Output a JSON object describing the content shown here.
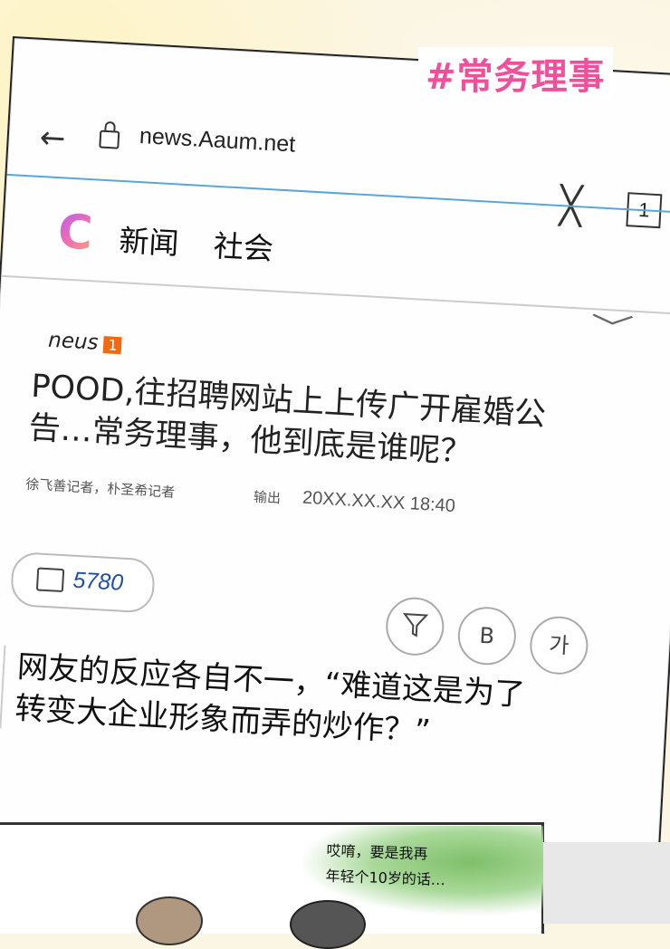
{
  "hashtag": "#常务理事",
  "browser": {
    "url": "news.Aaum.net",
    "tab_count": "1"
  },
  "site": {
    "logo_letter": "C",
    "nav": [
      "新闻",
      "社会"
    ]
  },
  "article": {
    "source": "neus",
    "source_badge": "1",
    "headline_line1": "POOD,往招聘网站上上传广开雇婚公",
    "headline_line2": "告…常务理事，他到底是谁呢？",
    "reporters": "徐飞善记者，朴圣希记者",
    "output_label": "输出",
    "date": "20XX.XX.XX 18:40",
    "comment_count": "5780",
    "font_button": "가",
    "summary_button": "B"
  },
  "quote": {
    "line1": "网友的反应各自不一，“难道这是为了",
    "line2": "转变大企业形象而弄的炒作？”"
  },
  "comic": {
    "speech_line1": "哎唷，要是我再",
    "speech_line2": "年轻个10岁的话…"
  }
}
